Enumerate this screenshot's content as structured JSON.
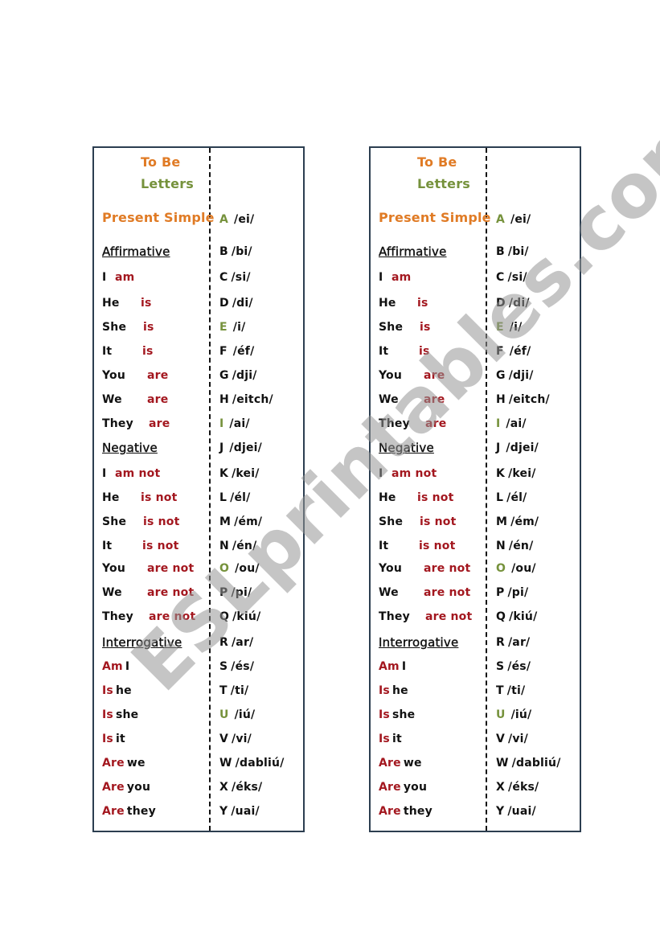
{
  "colors": {
    "border": "#2c3e50",
    "orange": "#e07b25",
    "green": "#76923c",
    "red": "#a3171f",
    "watermark": "#969696"
  },
  "watermark": "ESLprintables.com",
  "cards": [
    {
      "title": "To Be",
      "subtitle": "Letters",
      "section_title": "Present Simple",
      "headings": {
        "affirmative": "Affirmative",
        "negative": "Negative",
        "interrogative": "Interrogative"
      },
      "affirmative": [
        {
          "subject": "I",
          "verb": "am"
        },
        {
          "subject": "He",
          "verb": "is"
        },
        {
          "subject": "She",
          "verb": "is"
        },
        {
          "subject": "It",
          "verb": "is"
        },
        {
          "subject": "You",
          "verb": "are"
        },
        {
          "subject": "We",
          "verb": "are"
        },
        {
          "subject": "They",
          "verb": "are"
        }
      ],
      "negative": [
        {
          "subject": "I",
          "verb": "am not"
        },
        {
          "subject": "He",
          "verb": "is not"
        },
        {
          "subject": "She",
          "verb": "is not"
        },
        {
          "subject": "It",
          "verb": "is not"
        },
        {
          "subject": "You",
          "verb": "are not"
        },
        {
          "subject": "We",
          "verb": "are not"
        },
        {
          "subject": "They",
          "verb": "are not"
        }
      ],
      "interrogative": [
        {
          "verb": "Am",
          "subject": "I"
        },
        {
          "verb": "Is",
          "subject": "he"
        },
        {
          "verb": "Is",
          "subject": "she"
        },
        {
          "verb": "Is",
          "subject": "it"
        },
        {
          "verb": "Are",
          "subject": "we"
        },
        {
          "verb": "Are",
          "subject": "you"
        },
        {
          "verb": "Are",
          "subject": "they"
        }
      ],
      "letters": [
        {
          "letter": "A",
          "sound": "/ei/",
          "vowel": true
        },
        {
          "letter": "B",
          "sound": "/bi/",
          "vowel": false
        },
        {
          "letter": "C",
          "sound": "/si/",
          "vowel": false
        },
        {
          "letter": "D",
          "sound": "/di/",
          "vowel": false
        },
        {
          "letter": "E",
          "sound": "/i/",
          "vowel": true
        },
        {
          "letter": "F",
          "sound": "/éf/",
          "vowel": false
        },
        {
          "letter": "G",
          "sound": "/dji/",
          "vowel": false
        },
        {
          "letter": "H",
          "sound": "/eitch/",
          "vowel": false
        },
        {
          "letter": "I",
          "sound": "/ai/",
          "vowel": true
        },
        {
          "letter": "J",
          "sound": "/djei/",
          "vowel": false
        },
        {
          "letter": "K",
          "sound": "/kei/",
          "vowel": false
        },
        {
          "letter": "L",
          "sound": "/él/",
          "vowel": false
        },
        {
          "letter": "M",
          "sound": "/ém/",
          "vowel": false
        },
        {
          "letter": "N",
          "sound": "/én/",
          "vowel": false
        },
        {
          "letter": "O",
          "sound": "/ou/",
          "vowel": true
        },
        {
          "letter": "P",
          "sound": "/pi/",
          "vowel": false
        },
        {
          "letter": "Q",
          "sound": "/kiú/",
          "vowel": false
        },
        {
          "letter": "R",
          "sound": "/ar/",
          "vowel": false
        },
        {
          "letter": "S",
          "sound": "/és/",
          "vowel": false
        },
        {
          "letter": "T",
          "sound": "/ti/",
          "vowel": false
        },
        {
          "letter": "U",
          "sound": "/iú/",
          "vowel": true
        },
        {
          "letter": "V",
          "sound": "/vi/",
          "vowel": false
        },
        {
          "letter": "W",
          "sound": "/dabliú/",
          "vowel": false
        },
        {
          "letter": "X",
          "sound": "/éks/",
          "vowel": false
        },
        {
          "letter": "Y",
          "sound": "/uai/",
          "vowel": false
        }
      ]
    },
    {
      "title": "To Be",
      "subtitle": "Letters",
      "section_title": "Present Simple",
      "headings": {
        "affirmative": "Affirmative",
        "negative": "Negative",
        "interrogative": "Interrogative"
      },
      "affirmative": [
        {
          "subject": "I",
          "verb": "am"
        },
        {
          "subject": "He",
          "verb": "is"
        },
        {
          "subject": "She",
          "verb": "is"
        },
        {
          "subject": "It",
          "verb": "is"
        },
        {
          "subject": "You",
          "verb": "are"
        },
        {
          "subject": "We",
          "verb": "are"
        },
        {
          "subject": "They",
          "verb": "are"
        }
      ],
      "negative": [
        {
          "subject": "I",
          "verb": "am not"
        },
        {
          "subject": "He",
          "verb": "is not"
        },
        {
          "subject": "She",
          "verb": "is not"
        },
        {
          "subject": "It",
          "verb": "is not"
        },
        {
          "subject": "You",
          "verb": "are not"
        },
        {
          "subject": "We",
          "verb": "are not"
        },
        {
          "subject": "They",
          "verb": "are not"
        }
      ],
      "interrogative": [
        {
          "verb": "Am",
          "subject": "I"
        },
        {
          "verb": "Is",
          "subject": "he"
        },
        {
          "verb": "Is",
          "subject": "she"
        },
        {
          "verb": "Is",
          "subject": "it"
        },
        {
          "verb": "Are",
          "subject": "we"
        },
        {
          "verb": "Are",
          "subject": "you"
        },
        {
          "verb": "Are",
          "subject": "they"
        }
      ],
      "letters": [
        {
          "letter": "A",
          "sound": "/ei/",
          "vowel": true
        },
        {
          "letter": "B",
          "sound": "/bi/",
          "vowel": false
        },
        {
          "letter": "C",
          "sound": "/si/",
          "vowel": false
        },
        {
          "letter": "D",
          "sound": "/di/",
          "vowel": false
        },
        {
          "letter": "E",
          "sound": "/i/",
          "vowel": true
        },
        {
          "letter": "F",
          "sound": "/éf/",
          "vowel": false
        },
        {
          "letter": "G",
          "sound": "/dji/",
          "vowel": false
        },
        {
          "letter": "H",
          "sound": "/eitch/",
          "vowel": false
        },
        {
          "letter": "I",
          "sound": "/ai/",
          "vowel": true
        },
        {
          "letter": "J",
          "sound": "/djei/",
          "vowel": false
        },
        {
          "letter": "K",
          "sound": "/kei/",
          "vowel": false
        },
        {
          "letter": "L",
          "sound": "/él/",
          "vowel": false
        },
        {
          "letter": "M",
          "sound": "/ém/",
          "vowel": false
        },
        {
          "letter": "N",
          "sound": "/én/",
          "vowel": false
        },
        {
          "letter": "O",
          "sound": "/ou/",
          "vowel": true
        },
        {
          "letter": "P",
          "sound": "/pi/",
          "vowel": false
        },
        {
          "letter": "Q",
          "sound": "/kiú/",
          "vowel": false
        },
        {
          "letter": "R",
          "sound": "/ar/",
          "vowel": false
        },
        {
          "letter": "S",
          "sound": "/és/",
          "vowel": false
        },
        {
          "letter": "T",
          "sound": "/ti/",
          "vowel": false
        },
        {
          "letter": "U",
          "sound": "/iú/",
          "vowel": true
        },
        {
          "letter": "V",
          "sound": "/vi/",
          "vowel": false
        },
        {
          "letter": "W",
          "sound": "/dabliú/",
          "vowel": false
        },
        {
          "letter": "X",
          "sound": "/éks/",
          "vowel": false
        },
        {
          "letter": "Y",
          "sound": "/uai/",
          "vowel": false
        }
      ]
    }
  ]
}
